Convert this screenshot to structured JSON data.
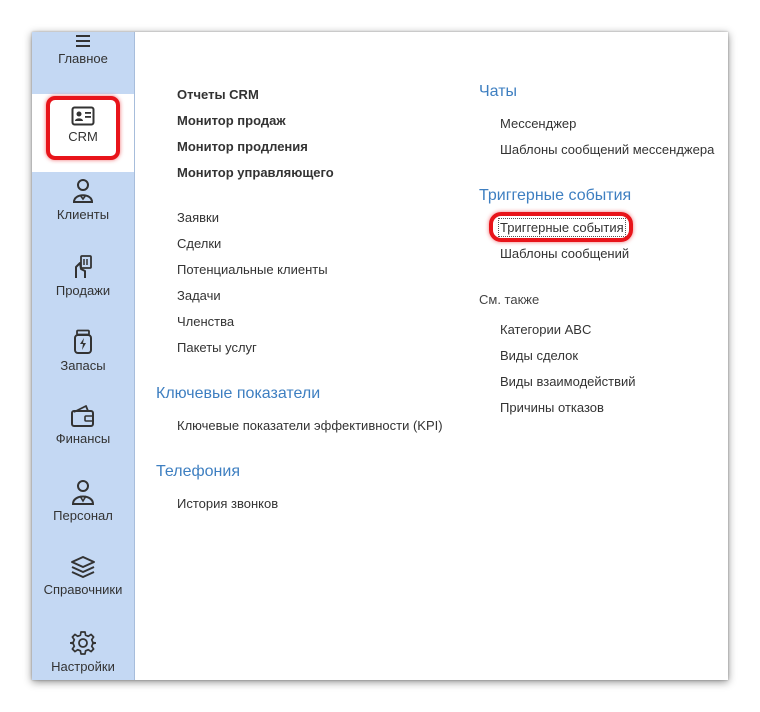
{
  "sidebar": {
    "items": [
      {
        "label": "Главное",
        "icon": "menu-icon"
      },
      {
        "label": "CRM",
        "icon": "contact-card-icon",
        "active": true
      },
      {
        "label": "Клиенты",
        "icon": "client-person-icon"
      },
      {
        "label": "Продажи",
        "icon": "sales-hand-icon"
      },
      {
        "label": "Запасы",
        "icon": "inventory-jar-icon"
      },
      {
        "label": "Финансы",
        "icon": "wallet-icon"
      },
      {
        "label": "Персонал",
        "icon": "staff-person-icon"
      },
      {
        "label": "Справочники",
        "icon": "layers-icon"
      },
      {
        "label": "Настройки",
        "icon": "gear-icon"
      }
    ]
  },
  "main": {
    "col1": {
      "bold_links": [
        "Отчеты CRM",
        "Монитор продаж",
        "Монитор продления",
        "Монитор управляющего"
      ],
      "links": [
        "Заявки",
        "Сделки",
        "Потенциальные клиенты",
        "Задачи",
        "Членства",
        "Пакеты услуг"
      ],
      "kpi": {
        "header": "Ключевые показатели",
        "links": [
          "Ключевые показатели эффективности (KPI)"
        ]
      },
      "telephony": {
        "header": "Телефония",
        "links": [
          "История звонков"
        ]
      }
    },
    "col2": {
      "chats": {
        "header": "Чаты",
        "links": [
          "Мессенджер",
          "Шаблоны сообщений мессенджера"
        ]
      },
      "triggers": {
        "header": "Триггерные события",
        "links": [
          "Триггерные события",
          "Шаблоны сообщений"
        ]
      },
      "see_also": {
        "header": "См. также",
        "links": [
          "Категории ABC",
          "Виды сделок",
          "Виды взаимодействий",
          "Причины отказов"
        ]
      }
    }
  },
  "colors": {
    "sidebar_bg": "#c4d8f3",
    "section_header": "#3e7fc1",
    "highlight": "#e8141a"
  }
}
